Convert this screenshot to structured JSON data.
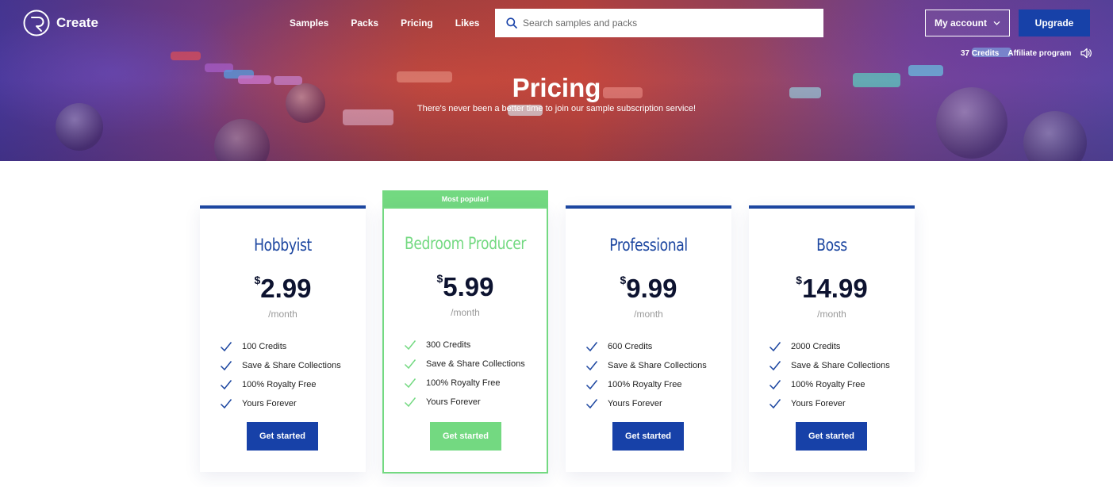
{
  "brand": {
    "name": "Create"
  },
  "nav": {
    "items": [
      "Samples",
      "Packs",
      "Pricing",
      "Likes"
    ]
  },
  "search": {
    "placeholder": "Search samples and packs",
    "value": ""
  },
  "account": {
    "label": "My account",
    "upgrade_label": "Upgrade"
  },
  "subnav": {
    "credits": "37 Credits",
    "affiliate": "Affiliate program"
  },
  "hero": {
    "title": "Pricing",
    "subtitle": "There's never been a better time to join our sample subscription service!"
  },
  "popular_badge": "Most popular!",
  "colors": {
    "accent": "#1741a8",
    "popular": "#73d981",
    "text": "#0d1330"
  },
  "plans": [
    {
      "name": "Hobbyist",
      "currency": "$",
      "price": "2.99",
      "period": "/month",
      "features": [
        "100 Credits",
        "Save & Share Collections",
        "100% Royalty Free",
        "Yours Forever"
      ],
      "cta": "Get started"
    },
    {
      "name": "Bedroom Producer",
      "currency": "$",
      "price": "5.99",
      "period": "/month",
      "features": [
        "300 Credits",
        "Save & Share Collections",
        "100% Royalty Free",
        "Yours Forever"
      ],
      "cta": "Get started"
    },
    {
      "name": "Professional",
      "currency": "$",
      "price": "9.99",
      "period": "/month",
      "features": [
        "600 Credits",
        "Save & Share Collections",
        "100% Royalty Free",
        "Yours Forever"
      ],
      "cta": "Get started"
    },
    {
      "name": "Boss",
      "currency": "$",
      "price": "14.99",
      "period": "/month",
      "features": [
        "2000 Credits",
        "Save & Share Collections",
        "100% Royalty Free",
        "Yours Forever"
      ],
      "cta": "Get started"
    }
  ]
}
